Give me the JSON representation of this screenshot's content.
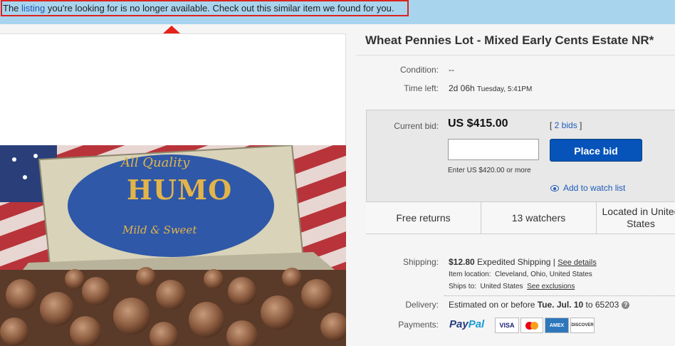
{
  "banner": {
    "prefix": "The ",
    "link": "listing",
    "suffix": " you're looking for is no longer available. Check out this similar item we found for you."
  },
  "item": {
    "title": "Wheat Pennies Lot - Mixed Early Cents Estate NR*",
    "condition_label": "Condition:",
    "condition_value": "--",
    "time_left_label": "Time left:",
    "time_left_value": "2d 06h",
    "time_left_end": "Tuesday, 5:41PM"
  },
  "bid": {
    "current_label": "Current bid:",
    "amount": "US $415.00",
    "bids_open": "[ ",
    "bids_link": "2 bids",
    "bids_close": " ]",
    "input_placeholder": "",
    "place_bid_label": "Place bid",
    "enter_hint": "Enter US $420.00 or more",
    "watch_label": "Add to watch list"
  },
  "features": [
    {
      "label": "Free returns"
    },
    {
      "label": "13 watchers"
    },
    {
      "label": "Located in United States"
    }
  ],
  "shipping": {
    "label": "Shipping:",
    "cost": "$12.80",
    "method": "Expedited Shipping |",
    "details_link": "See details",
    "location_label": "Item location:",
    "location_value": "Cleveland, Ohio, United States",
    "ships_to_label": "Ships to:",
    "ships_to_value": "United States",
    "exclusions_link": "See exclusions"
  },
  "delivery": {
    "label": "Delivery:",
    "prefix": "Estimated on or before ",
    "date": "Tue. Jul. 10",
    "to": " to 65203"
  },
  "payments": {
    "label": "Payments:",
    "paypal_a": "Pay",
    "paypal_b": "Pal",
    "cards": [
      "VISA",
      "MC",
      "AMEX",
      "DISCOVER"
    ]
  },
  "photo": {
    "tin_line1": "All Quality",
    "tin_brand": "HUMO",
    "tin_line2": "Mild & Sweet"
  },
  "colors": {
    "banner_bg": "#a9d4ee",
    "banner_border": "#d9231d",
    "arrow": "#e5231b",
    "link": "#1e5bb8",
    "place_bid": "#0654ba"
  }
}
